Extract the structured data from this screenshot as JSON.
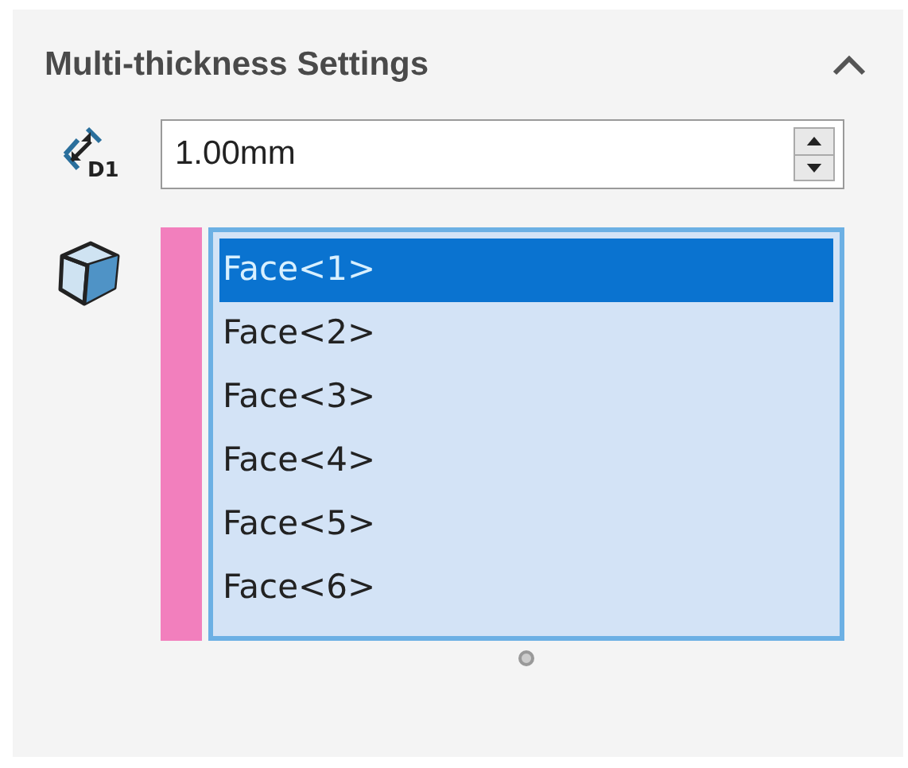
{
  "section": {
    "title": "Multi-thickness Settings",
    "expanded": true
  },
  "thickness": {
    "icon_label": "D1",
    "value": "1.00mm"
  },
  "faces": {
    "color": "#f27fbd",
    "items": [
      {
        "label": "Face<1>",
        "selected": true
      },
      {
        "label": "Face<2>",
        "selected": false
      },
      {
        "label": "Face<3>",
        "selected": false
      },
      {
        "label": "Face<4>",
        "selected": false
      },
      {
        "label": "Face<5>",
        "selected": false
      },
      {
        "label": "Face<6>",
        "selected": false
      }
    ]
  }
}
